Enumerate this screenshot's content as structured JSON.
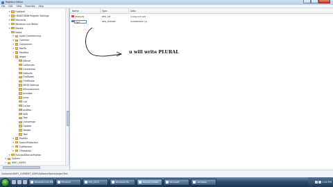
{
  "window": {
    "title": "Registry Editor"
  },
  "menu": [
    "File",
    "Edit",
    "View",
    "Favorites",
    "Help"
  ],
  "tree": {
    "items": [
      {
        "label": "FlatMedi",
        "depth": 1,
        "expander": "+"
      },
      {
        "label": "HEADSTANB Program Settings",
        "depth": 1,
        "expander": "+"
      },
      {
        "label": "Macrovisi",
        "depth": 1,
        "expander": "+"
      },
      {
        "label": "Windows Live Writer",
        "depth": 1,
        "expander": "+"
      },
      {
        "label": "Mozilla",
        "depth": 1,
        "expander": "+"
      },
      {
        "label": "Nokia",
        "depth": 1,
        "expander": "-"
      },
      {
        "label": "Audio Conferencing",
        "depth": 2,
        "expander": "+"
      },
      {
        "label": "Common",
        "depth": 2,
        "expander": "+"
      },
      {
        "label": "Companion",
        "depth": 2,
        "expander": "+"
      },
      {
        "label": "MedTo",
        "depth": 2,
        "expander": "+"
      },
      {
        "label": "PaceBox",
        "depth": 2,
        "expander": "+"
      },
      {
        "label": "Jorger",
        "depth": 2,
        "expander": "-"
      },
      {
        "label": "ABoud",
        "depth": 3,
        "expander": ""
      },
      {
        "label": "CalSenvec",
        "depth": 3,
        "expander": ""
      },
      {
        "label": "Connection",
        "depth": 3,
        "expander": ""
      },
      {
        "label": "Defaults",
        "depth": 3,
        "expander": ""
      },
      {
        "label": "FindToken",
        "depth": 3,
        "expander": ""
      },
      {
        "label": "FindTasble",
        "depth": 3,
        "expander": ""
      },
      {
        "label": "NFO8 Settings",
        "depth": 3,
        "expander": ""
      },
      {
        "label": "IEEnvironment",
        "depth": 3,
        "expander": ""
      },
      {
        "label": "Invisible",
        "depth": 3,
        "expander": ""
      },
      {
        "label": "Jump",
        "depth": 3,
        "expander": ""
      },
      {
        "label": "List",
        "depth": 3,
        "expander": ""
      },
      {
        "label": "Locale",
        "depth": 3,
        "expander": ""
      },
      {
        "label": "proMax",
        "depth": 3,
        "expander": ""
      },
      {
        "label": "SMS",
        "depth": 3,
        "expander": ""
      },
      {
        "label": "Text",
        "depth": 3,
        "expander": ""
      },
      {
        "label": "Ucaslemge",
        "depth": 3,
        "expander": ""
      },
      {
        "label": "Update",
        "depth": 3,
        "expander": ""
      },
      {
        "label": "Voegte",
        "depth": 3,
        "expander": ""
      },
      {
        "label": "Tool",
        "depth": 3,
        "expander": ""
      },
      {
        "label": "ProtMkr",
        "depth": 2,
        "expander": "+"
      },
      {
        "label": "SearchProtection",
        "depth": 2,
        "expander": "+"
      },
      {
        "label": "SubMonitor",
        "depth": 2,
        "expander": "+"
      },
      {
        "label": "TPresetAkr",
        "depth": 2,
        "expander": "+"
      },
      {
        "label": "PoliciesWiternetProfiler",
        "depth": 1,
        "expander": "+"
      },
      {
        "label": "System",
        "depth": 0,
        "expander": "+"
      },
      {
        "label": "HKEY_USERS",
        "depth": 0,
        "expander": "+"
      }
    ]
  },
  "list": {
    "columns": [
      "Name",
      "Type",
      "Data"
    ],
    "rows": [
      {
        "name": "(Default)",
        "type": "REG_SZ",
        "data": "(value not set)",
        "icon": "string-value-icon",
        "editing": false
      },
      {
        "name": "Text",
        "type": "REG_DWORD",
        "data": "0x00000001 (1)",
        "icon": "binary-value-icon",
        "editing": true
      }
    ]
  },
  "annotation": {
    "text": "u will write PLURAL"
  },
  "status": {
    "path": "Computer\\HKEY_CURRENT_USER\\Software\\Nokia\\Jorger\\Text"
  },
  "taskbar": {
    "buttons": [
      {
        "label": "Windows Live Mes",
        "active": false
      },
      {
        "label": "Personal",
        "active": false
      },
      {
        "label": "IMG_0015",
        "active": false
      },
      {
        "label": "Windows Mo",
        "active": false
      },
      {
        "label": "Registry Editor",
        "active": true
      },
      {
        "label": "Microsoft",
        "active": false
      },
      {
        "label": "Camtasia",
        "active": false
      }
    ],
    "clock": "1:54 PM"
  },
  "colors": {
    "selection": "#3399ff",
    "taskbar": "#2c4b6c"
  }
}
